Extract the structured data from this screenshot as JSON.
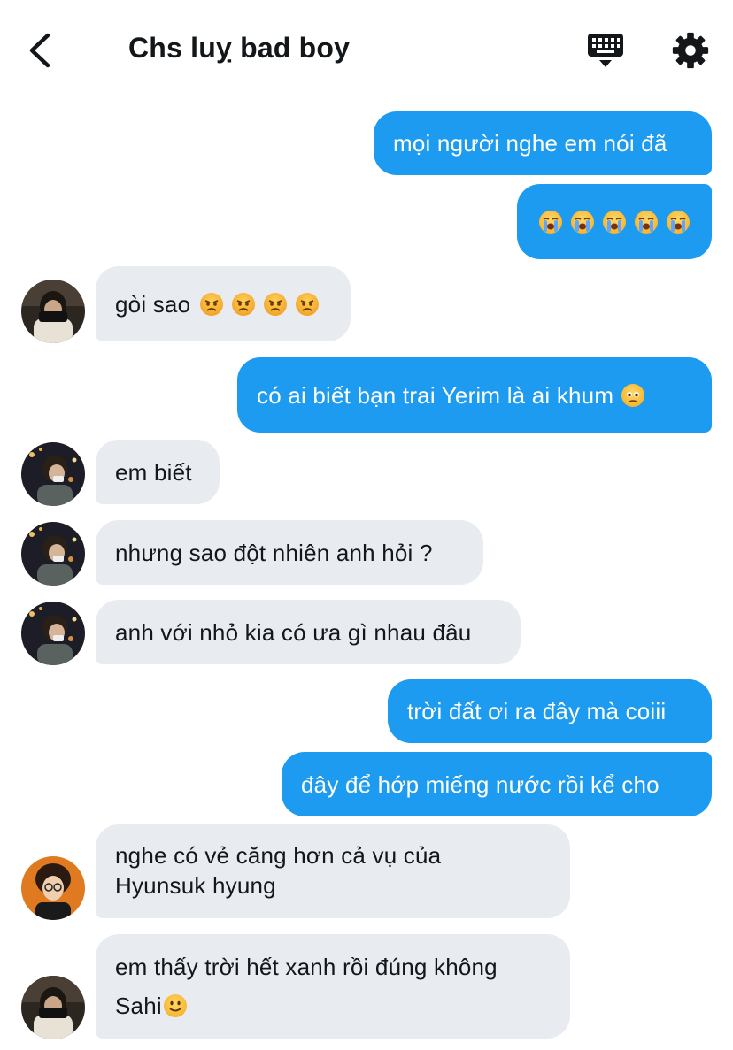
{
  "header": {
    "title": "Chs luỵ bad boy",
    "back_icon": "chevron-left-icon",
    "keyboard_icon": "keyboard-icon",
    "settings_icon": "gear-icon"
  },
  "colors": {
    "outgoing_bubble": "#1d9bf0",
    "incoming_bubble": "#e8ecf0",
    "text": "#14171a"
  },
  "messages": [
    {
      "direction": "out",
      "text": "mọi người nghe em nói đã"
    },
    {
      "direction": "out",
      "text": "",
      "emojis": [
        "loudly-crying-face",
        "loudly-crying-face",
        "loudly-crying-face",
        "loudly-crying-face",
        "loudly-crying-face"
      ]
    },
    {
      "direction": "in",
      "text": "gòi sao",
      "emojis": [
        "angry-face",
        "angry-face",
        "angry-face",
        "angry-face"
      ],
      "avatar": "avatar-a"
    },
    {
      "direction": "out",
      "text": "có ai biết bạn trai Yerim là ai khum",
      "emojis": [
        "face-holding-back-tears"
      ]
    },
    {
      "direction": "in",
      "text": "em biết",
      "avatar": "avatar-b"
    },
    {
      "direction": "in",
      "text": "nhưng sao đột nhiên anh hỏi ?",
      "avatar": "avatar-b"
    },
    {
      "direction": "in",
      "text": "anh với nhỏ kia có ưa gì nhau đâu",
      "avatar": "avatar-b"
    },
    {
      "direction": "out",
      "text": "trời đất ơi ra đây mà coiii"
    },
    {
      "direction": "out",
      "text": "đây để hớp miếng nước rồi kể cho"
    },
    {
      "direction": "in",
      "text_line1": "nghe có vẻ căng hơn cả vụ của",
      "text_line2": "Hyunsuk hyung",
      "avatar": "avatar-c"
    },
    {
      "direction": "in",
      "text_line1": "em thấy trời hết xanh rồi đúng không",
      "text_line2": "Sahi",
      "emojis": [
        "slightly-smiling-face"
      ],
      "avatar": "avatar-a"
    }
  ]
}
